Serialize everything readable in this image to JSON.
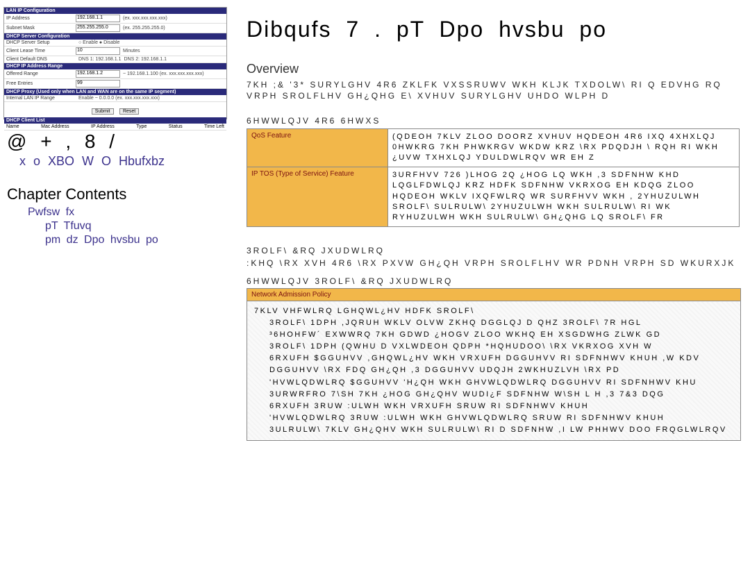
{
  "config_image": {
    "sections": [
      {
        "header": "LAN IP Configuration",
        "rows": [
          {
            "label": "IP Address",
            "value": "192.168.1.1",
            "extra": "(ex. xxx.xxx.xxx.xxx)"
          },
          {
            "label": "Subnet Mask",
            "value": "255.255.255.0",
            "extra": "(ex. 255.255.255.0)"
          }
        ]
      },
      {
        "header": "DHCP Server Configuration",
        "rows": [
          {
            "label": "DHCP Server Setup",
            "value": "",
            "extra": "○ Enable  ● Disable"
          },
          {
            "label": "Client Lease Time",
            "value": "10",
            "extra": "Minutes"
          },
          {
            "label": "Client Default DNS",
            "value": "DNS 1: 192.168.1.1",
            "extra": "DNS 2: 192.168.1.1"
          }
        ]
      },
      {
        "header": "DHCP IP Address Range",
        "rows": [
          {
            "label": "Offered Range",
            "value": "192.168.1.2",
            "extra": "~ 192.168.1.100   (ex. xxx.xxx.xxx.xxx)"
          },
          {
            "label": "Free Entries",
            "value": "99",
            "extra": ""
          }
        ]
      },
      {
        "header": "DHCP Proxy (Used only when LAN and WAN are on the same IP segment)",
        "rows": [
          {
            "label": "Internal LAN IP Range",
            "value": "",
            "extra": "Enable  ~ 0.0.0.0   (ex. xxx.xxx.xxx.xxx)"
          }
        ]
      },
      {
        "header": "DHCP Client List",
        "table_header": [
          "Name",
          "Mac Address",
          "IP Address",
          "Type",
          "Status",
          "Time Left"
        ]
      }
    ],
    "buttons": [
      "Submit",
      "Reset"
    ]
  },
  "sidebar": {
    "big": "@ + , 8 /",
    "subtitle": "x  o  XBO  W  O  Hbufxbz",
    "contents_label": "Chapter Contents",
    "item1": "Pwfsw  fx",
    "item2": "pT  Tfuvq",
    "item3": "pm  dz  Dpo  hvsbu  po"
  },
  "main": {
    "title": "Dibqufs  7  .    pT  Dpo  hvsbu  po",
    "overview_label": "Overview",
    "overview_text": "7KH ;& '3*   SURYLGHV 4R6  ZKLFK VXSSRUWV WKH KLJK TXDOLW\\ RI Q EDVHG RQ VRPH SROLFLHV GH¿QHG E\\ XVHUV SURYLGHV UHDO WLPH D",
    "setup_path": "6HWWLQJV   4R6 6HWXS",
    "table1": [
      {
        "left": "QoS Feature",
        "right": "(QDEOH 7KLV ZLOO DOORZ XVHUV HQDEOH 4R6 IXQ 4XHXLQJ 0HWKRG 7KH PHWKRGV WKDW KRZ \\RX PDQDJH \\ RQH RI WKH ¿UVW TXHXLQJ YDULDWLRQV WR EH Z"
      },
      {
        "left": "IP TOS (Type of Service) Feature",
        "right": "3URFHVV 726 )LHOG 2Q ¿HOG LQ WKH ,3 SDFNHW KHD LQGLFDWLQJ KRZ HDFK SDFNHW VKRXOG EH KDQG ZLOO HQDEOH WKLV IXQFWLRQ WR SURFHVV WKH , 2YHUZULWH SROLF\\ SULRULW\\ 2YHUZULWH WKH SULRULW\\ RI WK RYHUZULWH WKH SULRULW\\ GH¿QHG LQ SROLF\\ FR"
      }
    ],
    "policy_path": "3ROLF\\ &RQ JXUDWLRQ",
    "policy_intro": ":KHQ \\RX XVH 4R6  \\RX PXVW GH¿QH VRPH SROLFLHV WR PDNH VRPH SD WKURXJK",
    "policy_setpath": "6HWWLQJV   3ROLF\\ &RQ JXUDWLRQ",
    "policy_table_header": "Network Admission Policy",
    "policy_body_lines": [
      "7KLV VHFWLRQ LGHQWL¿HV HDFK SROLF\\",
      "3ROLF\\ 1DPH ,JQRUH WKLV OLVW ZKHQ DGGLQJ D QHZ 3ROLF\\  7R HGL",
      "³6HOHFW´ EXWWRQ  7KH GDWD ¿HOGV ZLOO WKHQ EH XSGDWHG ZLWK GD",
      "3ROLF\\ 1DPH (QWHU D VXLWDEOH QDPH  *HQHUDOO\\  \\RX VKRXOG XVH W",
      "6RXUFH $GGUHVV  ,GHQWL¿HV WKH VRXUFH DGGUHVV RI SDFNHWV KHUH  ,W KDV",
      "DGGUHVV  \\RX FDQ GH¿QH ,3 DGGUHVV UDQJH  2WKHUZLVH  \\RX PD",
      "'HVWLQDWLRQ $GGUHVV 'H¿QH WKH GHVWLQDWLRQ DGGUHVV RI SDFNHWV KHU",
      "3URWRFRO 7\\SH 7KH ¿HOG GH¿QHV WUDI¿F SDFNHW W\\SH  L H  ,3 7&3 DQG",
      "6RXUFH 3RUW :ULWH WKH VRXUFH SRUW RI SDFNHWV KHUH",
      "'HVWLQDWLRQ 3RUW :ULWH WKH GHVWLQDWLRQ SRUW RI SDFNHWV KHUH",
      "3ULRULW\\ 7KLV GH¿QHV WKH SULRULW\\ RI D SDFNHW  ,I LW PHHWV DOO FRQGLWLRQV"
    ]
  }
}
